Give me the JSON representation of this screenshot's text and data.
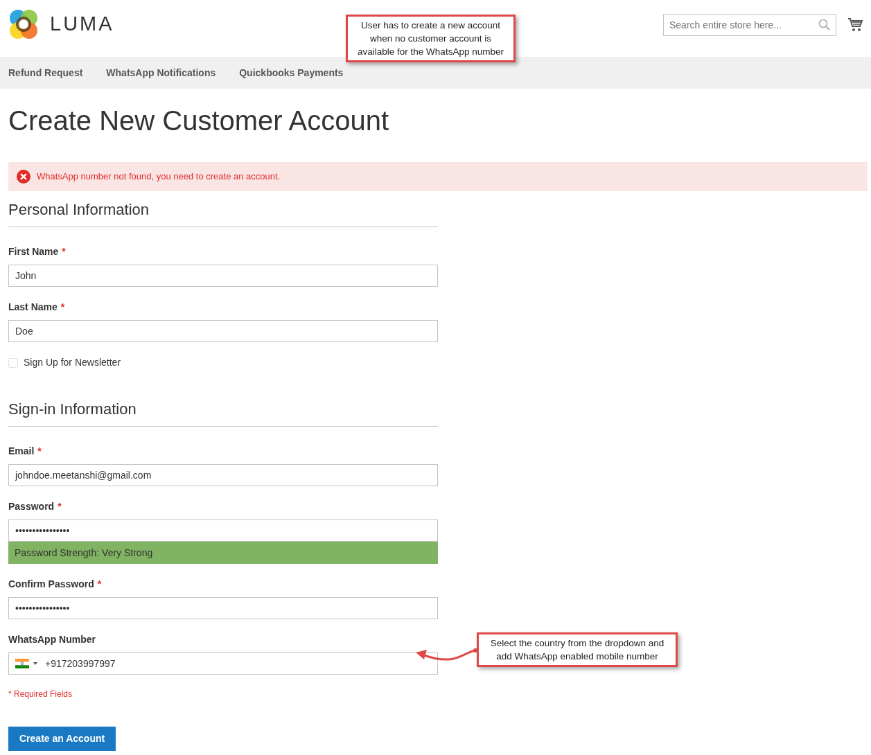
{
  "header": {
    "logo_text": "LUMA",
    "search": {
      "placeholder": "Search entire store here..."
    }
  },
  "nav": [
    {
      "label": "Refund Request"
    },
    {
      "label": "WhatsApp Notifications"
    },
    {
      "label": "Quickbooks Payments"
    }
  ],
  "page_title": "Create New Customer Account",
  "error_message": "WhatsApp number not found, you need to create an account.",
  "sections": [
    {
      "title": "Personal Information",
      "fields": [
        {
          "kind": "text",
          "label": "First Name",
          "required_mark": "*",
          "value": "John"
        },
        {
          "kind": "text",
          "label": "Last Name",
          "required_mark": "*",
          "value": "Doe"
        },
        {
          "kind": "checkbox",
          "label": "Sign Up for Newsletter",
          "checked": false
        }
      ]
    },
    {
      "title": "Sign-in Information",
      "fields": [
        {
          "kind": "text",
          "label": "Email",
          "required_mark": "*",
          "value": "johndoe.meetanshi@gmail.com"
        },
        {
          "kind": "password",
          "label": "Password",
          "required_mark": "*",
          "value": "••••••••••••••••",
          "strength": "Password Strength: Very Strong"
        },
        {
          "kind": "text",
          "label": "Confirm Password",
          "required_mark": "*",
          "value": "••••••••••••••••"
        },
        {
          "kind": "phone",
          "label": "WhatsApp Number",
          "value": "+917203997997"
        }
      ]
    }
  ],
  "required_note": "* Required Fields",
  "submit_button": "Create an Account",
  "callouts": [
    {
      "kind": "top",
      "text": "User has to create a new account when no customer account is available for the WhatsApp number"
    },
    {
      "kind": "phone",
      "text": "Select the country from the dropdown and add WhatsApp enabled mobile number"
    }
  ]
}
